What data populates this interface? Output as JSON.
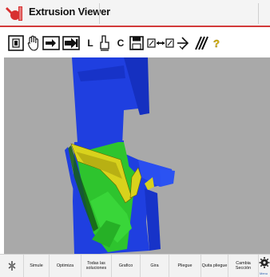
{
  "window": {
    "title": "Extrusion Viewer",
    "logo_icon": "app-logo-icon"
  },
  "toolbar": {
    "items": [
      {
        "name": "view-profile-icon"
      },
      {
        "name": "hand-pan-icon"
      },
      {
        "name": "arrow-into-box-icon"
      },
      {
        "name": "arrow-into-box-bold-icon"
      },
      {
        "name": "l-profile-button",
        "label": "L"
      },
      {
        "name": "person-section-icon"
      },
      {
        "name": "c-profile-button",
        "label": "C"
      },
      {
        "name": "save-disk-icon"
      },
      {
        "name": "swap-sections-icon"
      },
      {
        "name": "arrow-right-step-icon"
      },
      {
        "name": "parallel-lines-icon"
      },
      {
        "name": "help-question-icon",
        "label": "?"
      }
    ]
  },
  "bottom_bar": {
    "buttons": [
      {
        "name": "settings-button",
        "icon": "gear-bolt-icon",
        "label": ""
      },
      {
        "name": "simule-button",
        "label": "Simule"
      },
      {
        "name": "optimiza-button",
        "label": "Optimiza"
      },
      {
        "name": "todas-las-soluciones-button",
        "label": "Todas las soluciones"
      },
      {
        "name": "grafico-button",
        "label": "Grafico"
      },
      {
        "name": "gira-button",
        "label": "Gira"
      },
      {
        "name": "pliegue-button",
        "label": "Pliegue"
      },
      {
        "name": "quita-pliegue-button",
        "label": "Quita pliegue"
      },
      {
        "name": "cambia-seccion-button",
        "label": "Cambia Sección"
      }
    ],
    "menu": {
      "icon": "menu-gear-icon",
      "label": "Menu"
    }
  },
  "colors": {
    "viewport_bg": "#a9a9a9",
    "die_blue": "#1f3fe0",
    "profile_green": "#2ec42e",
    "profile_yellow": "#d9d21c",
    "accent_red": "#d23a3a"
  }
}
